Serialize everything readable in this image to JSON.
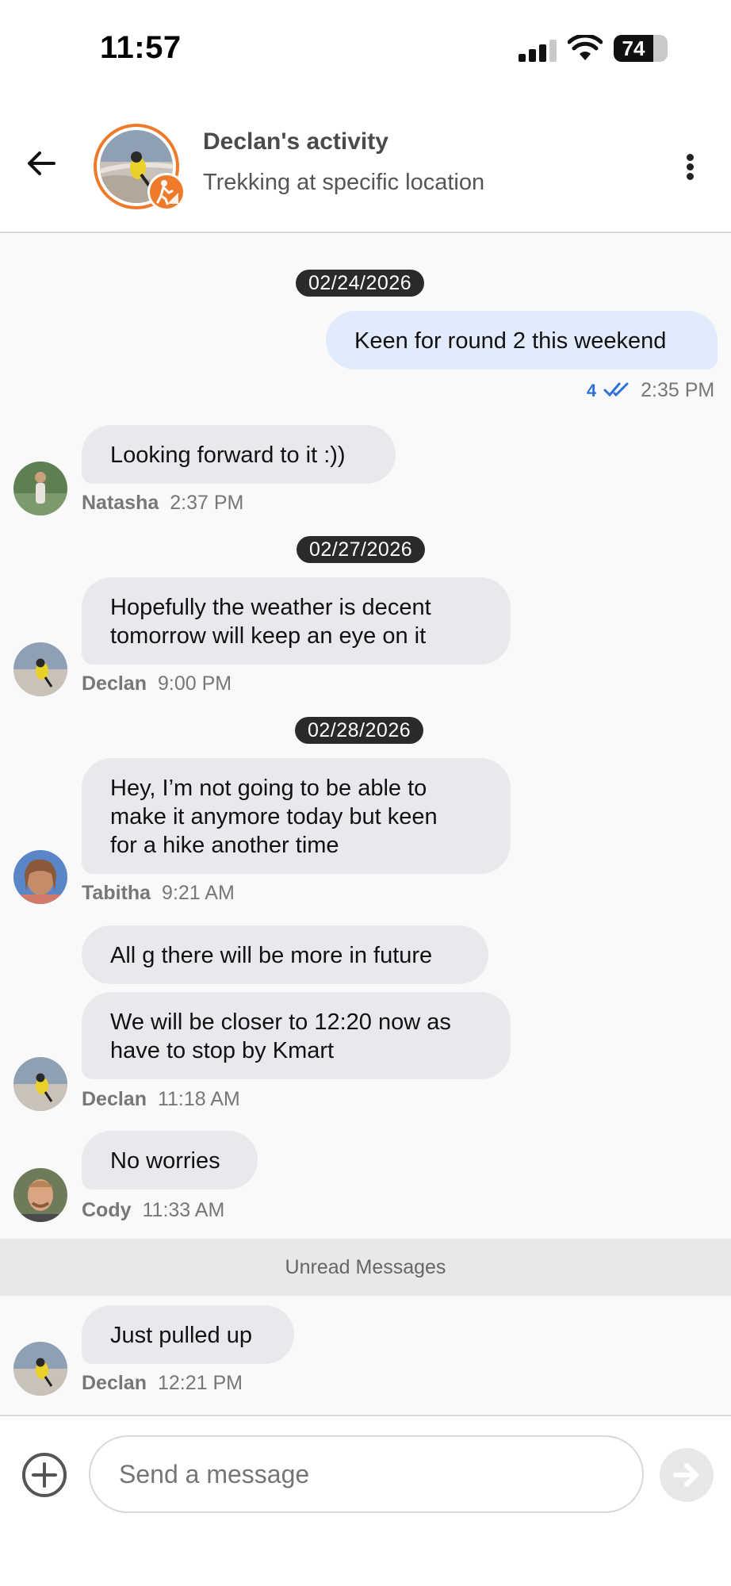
{
  "status_bar": {
    "time": "11:57",
    "battery": "74",
    "battery_level": 0.74
  },
  "header": {
    "title": "Declan's activity",
    "subtitle": "Trekking at specific location",
    "back_icon": "arrow-left-icon",
    "more_icon": "more-vertical-icon",
    "badge_icon": "hiker-icon"
  },
  "messages": {
    "date1": "02/24/2026",
    "m1": {
      "text": "Keen for round 2 this weekend",
      "read_count": "4",
      "time": "2:35 PM"
    },
    "m2": {
      "text": "Looking forward to it :))",
      "name": "Natasha",
      "time": "2:37 PM"
    },
    "date2": "02/27/2026",
    "m3": {
      "text1": "Hopefully the weather is decent",
      "text2": "tomorrow will keep an eye on it",
      "name": "Declan",
      "time": "9:00 PM"
    },
    "date3": "02/28/2026",
    "m4": {
      "text1": "Hey, I’m not going to be able to",
      "text2": "make it anymore today but keen",
      "text3": "for a hike another time",
      "name": "Tabitha",
      "time": "9:21 AM"
    },
    "m5": {
      "text": "All g there will be more in future"
    },
    "m6": {
      "text1": "We will be closer to 12:20 now as",
      "text2": "have to stop by Kmart",
      "name": "Declan",
      "time": "11:18 AM"
    },
    "m7": {
      "text": "No worries",
      "name": "Cody",
      "time": "11:33 AM"
    },
    "unread_label": "Unread Messages",
    "m8": {
      "text": "Just pulled up",
      "name": "Declan",
      "time": "12:21 PM"
    }
  },
  "composer": {
    "placeholder": "Send a message",
    "add_icon": "plus-circle-icon",
    "send_icon": "send-arrow-icon"
  }
}
